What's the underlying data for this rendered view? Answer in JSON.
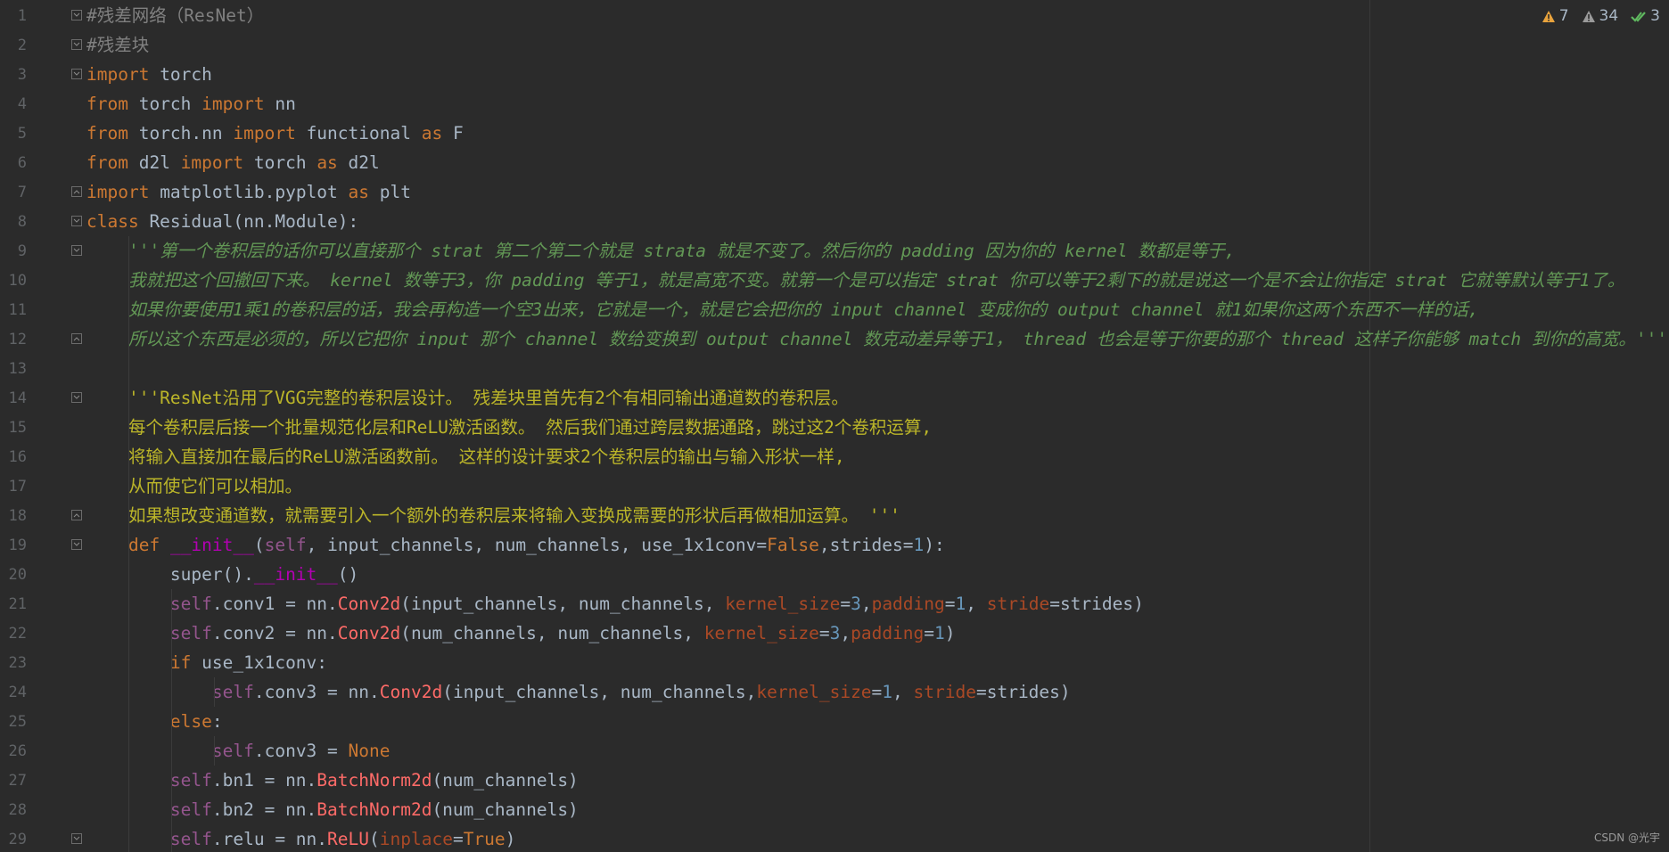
{
  "status": {
    "warnings_count": "7",
    "weak_warnings_count": "34",
    "ok_count": "3"
  },
  "watermark": "CSDN @光宇",
  "colors": {
    "background": "#2b2b2b",
    "keyword": "#cc7832",
    "docstring": "#629755",
    "string": "#bbb529",
    "self": "#94558d",
    "number": "#6897bb",
    "warning": "#e8a33d",
    "ok": "#5fb85f"
  },
  "lines": [
    {
      "n": "1",
      "text": "#残差网络（ResNet）"
    },
    {
      "n": "2",
      "text": "#残差块"
    },
    {
      "n": "3",
      "text": "import torch"
    },
    {
      "n": "4",
      "text": "from torch import nn"
    },
    {
      "n": "5",
      "text": "from torch.nn import functional as F"
    },
    {
      "n": "6",
      "text": "from d2l import torch as d2l"
    },
    {
      "n": "7",
      "text": "import matplotlib.pyplot as plt"
    },
    {
      "n": "8",
      "text": "class Residual(nn.Module):"
    },
    {
      "n": "9",
      "text": "    '''第一个卷积层的话你可以直接那个 strat 第二个第二个就是 strata 就是不变了。然后你的 padding 因为你的 kernel 数都是等于,"
    },
    {
      "n": "10",
      "text": "    我就把这个回撤回下来。 kernel 数等于3，你 padding 等于1，就是高宽不变。就第一个是可以指定 strat 你可以等于2剩下的就是说这一个是不会让你指定 strat 它就等默认等于1了。"
    },
    {
      "n": "11",
      "text": "    如果你要使用1乘1的卷积层的话，我会再构造一个空3出来，它就是一个，就是它会把你的 input channel 变成你的 output channel 就1如果你这两个东西不一样的话,"
    },
    {
      "n": "12",
      "text": "    所以这个东西是必须的，所以它把你 input 那个 channel 数给变换到 output channel 数克动差异等于1， thread 也会是等于你要的那个 thread 这样子你能够 match 到你的高宽。'''"
    },
    {
      "n": "13",
      "text": ""
    },
    {
      "n": "14",
      "text": "    '''ResNet沿用了VGG完整的卷积层设计。 残差块里首先有2个有相同输出通道数的卷积层。"
    },
    {
      "n": "15",
      "text": "    每个卷积层后接一个批量规范化层和ReLU激活函数。 然后我们通过跨层数据通路，跳过这2个卷积运算,"
    },
    {
      "n": "16",
      "text": "    将输入直接加在最后的ReLU激活函数前。 这样的设计要求2个卷积层的输出与输入形状一样,"
    },
    {
      "n": "17",
      "text": "    从而使它们可以相加。"
    },
    {
      "n": "18",
      "text": "    如果想改变通道数，就需要引入一个额外的卷积层来将输入变换成需要的形状后再做相加运算。 '''"
    },
    {
      "n": "19",
      "text": "    def __init__(self, input_channels, num_channels, use_1x1conv=False,strides=1):"
    },
    {
      "n": "20",
      "text": "        super().__init__()"
    },
    {
      "n": "21",
      "text": "        self.conv1 = nn.Conv2d(input_channels, num_channels, kernel_size=3,padding=1, stride=strides)"
    },
    {
      "n": "22",
      "text": "        self.conv2 = nn.Conv2d(num_channels, num_channels, kernel_size=3,padding=1)"
    },
    {
      "n": "23",
      "text": "        if use_1x1conv:"
    },
    {
      "n": "24",
      "text": "            self.conv3 = nn.Conv2d(input_channels, num_channels,kernel_size=1, stride=strides)"
    },
    {
      "n": "25",
      "text": "        else:"
    },
    {
      "n": "26",
      "text": "            self.conv3 = None"
    },
    {
      "n": "27",
      "text": "        self.bn1 = nn.BatchNorm2d(num_channels)"
    },
    {
      "n": "28",
      "text": "        self.bn2 = nn.BatchNorm2d(num_channels)"
    },
    {
      "n": "29",
      "text": "        self.relu = nn.ReLU(inplace=True)"
    }
  ]
}
